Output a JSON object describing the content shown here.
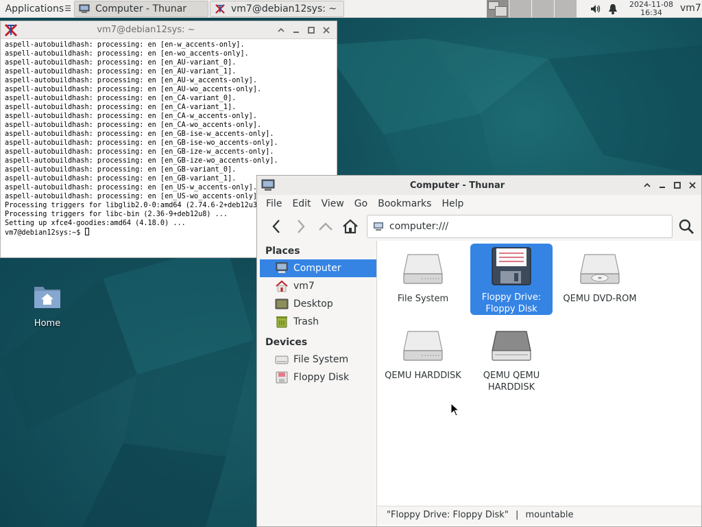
{
  "panel": {
    "apps_label": "Applications",
    "tasks": [
      {
        "label": "Computer - Thunar"
      },
      {
        "label": "vm7@debian12sys: ~"
      }
    ],
    "clock_date": "2024-11-08",
    "clock_time": "16:34",
    "user": "vm7"
  },
  "terminal": {
    "title": "vm7@debian12sys: ~",
    "lines": [
      "aspell-autobuildhash: processing: en [en-w_accents-only].",
      "aspell-autobuildhash: processing: en [en-wo_accents-only].",
      "aspell-autobuildhash: processing: en [en_AU-variant_0].",
      "aspell-autobuildhash: processing: en [en_AU-variant_1].",
      "aspell-autobuildhash: processing: en [en_AU-w_accents-only].",
      "aspell-autobuildhash: processing: en [en_AU-wo_accents-only].",
      "aspell-autobuildhash: processing: en [en_CA-variant_0].",
      "aspell-autobuildhash: processing: en [en_CA-variant_1].",
      "aspell-autobuildhash: processing: en [en_CA-w_accents-only].",
      "aspell-autobuildhash: processing: en [en_CA-wo_accents-only].",
      "aspell-autobuildhash: processing: en [en_GB-ise-w_accents-only].",
      "aspell-autobuildhash: processing: en [en_GB-ise-wo_accents-only].",
      "aspell-autobuildhash: processing: en [en_GB-ize-w_accents-only].",
      "aspell-autobuildhash: processing: en [en_GB-ize-wo_accents-only].",
      "aspell-autobuildhash: processing: en [en_GB-variant_0].",
      "aspell-autobuildhash: processing: en [en_GB-variant_1].",
      "aspell-autobuildhash: processing: en [en_US-w_accents-only].",
      "aspell-autobuildhash: processing: en [en_US-wo_accents-only].",
      "Processing triggers for libglib2.0-0:amd64 (2.74.6-2+deb12u3) ...",
      "Processing triggers for libc-bin (2.36-9+deb12u8) ...",
      "Setting up xfce4-goodies:amd64 (4.18.0) ..."
    ],
    "prompt": "vm7@debian12sys:~$ "
  },
  "desktop": {
    "home_label": "Home"
  },
  "thunar": {
    "title": "Computer - Thunar",
    "menu": [
      "File",
      "Edit",
      "View",
      "Go",
      "Bookmarks",
      "Help"
    ],
    "location": "computer:///",
    "places_heading": "Places",
    "places": [
      {
        "label": "Computer",
        "icon": "computer-icon"
      },
      {
        "label": "vm7",
        "icon": "home-folder-icon"
      },
      {
        "label": "Desktop",
        "icon": "desktop-icon"
      },
      {
        "label": "Trash",
        "icon": "trash-icon"
      }
    ],
    "devices_heading": "Devices",
    "devices": [
      {
        "label": "File System",
        "icon": "drive-icon"
      },
      {
        "label": "Floppy Disk",
        "icon": "floppy-icon"
      }
    ],
    "items": [
      {
        "label": "File System",
        "icon": "harddisk-icon"
      },
      {
        "label": "Floppy Drive: Floppy Disk",
        "icon": "floppy-disk-icon"
      },
      {
        "label": "QEMU DVD-ROM",
        "icon": "optical-drive-icon"
      },
      {
        "label": "QEMU HARDDISK",
        "icon": "harddisk-icon"
      },
      {
        "label": "QEMU QEMU HARDDISK",
        "icon": "harddisk-dark-icon"
      }
    ],
    "status_name": "\"Floppy Drive: Floppy Disk\"",
    "status_sep": "|",
    "status_type": "mountable"
  },
  "colors": {
    "selection": "#3584e4",
    "desktop": "#0f4b58"
  }
}
